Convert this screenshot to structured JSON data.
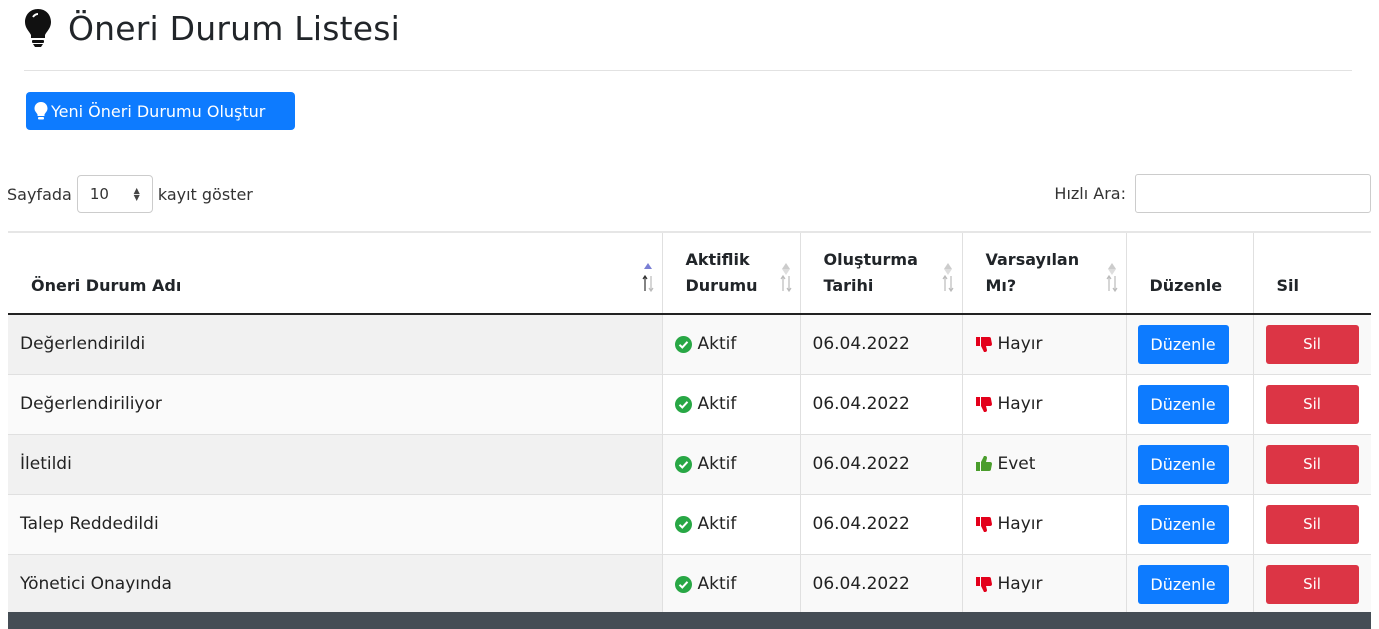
{
  "page": {
    "title": "Öneri Durum Listesi"
  },
  "create_button": {
    "label": "Yeni Öneri Durumu Oluştur"
  },
  "length_menu": {
    "prefix": "Sayfada",
    "value": "10",
    "suffix": "kayıt göster"
  },
  "search": {
    "label": "Hızlı Ara:",
    "value": ""
  },
  "table": {
    "headers": {
      "name": "Öneri Durum Adı",
      "active_line1": "Aktiflik",
      "active_line2": "Durumu",
      "date_line1": "Oluşturma",
      "date_line2": "Tarihi",
      "default_line1": "Varsayılan",
      "default_line2": "Mı?",
      "edit": "Düzenle",
      "delete": "Sil"
    },
    "rows": [
      {
        "name": "Değerlendirildi",
        "active": "Aktif",
        "date": "06.04.2022",
        "default": "Hayır",
        "edit": "Düzenle",
        "delete": "Sil"
      },
      {
        "name": "Değerlendiriliyor",
        "active": "Aktif",
        "date": "06.04.2022",
        "default": "Hayır",
        "edit": "Düzenle",
        "delete": "Sil"
      },
      {
        "name": "İletildi",
        "active": "Aktif",
        "date": "06.04.2022",
        "default": "Evet",
        "edit": "Düzenle",
        "delete": "Sil"
      },
      {
        "name": "Talep Reddedildi",
        "active": "Aktif",
        "date": "06.04.2022",
        "default": "Hayır",
        "edit": "Düzenle",
        "delete": "Sil"
      },
      {
        "name": "Yönetici Onayında",
        "active": "Aktif",
        "date": "06.04.2022",
        "default": "Hayır",
        "edit": "Düzenle",
        "delete": "Sil"
      }
    ]
  },
  "colors": {
    "primary": "#0d7bff",
    "danger": "#dc3545",
    "success": "#28a745",
    "thumb_down": "#e3001b",
    "thumb_up": "#4a9d2c"
  }
}
